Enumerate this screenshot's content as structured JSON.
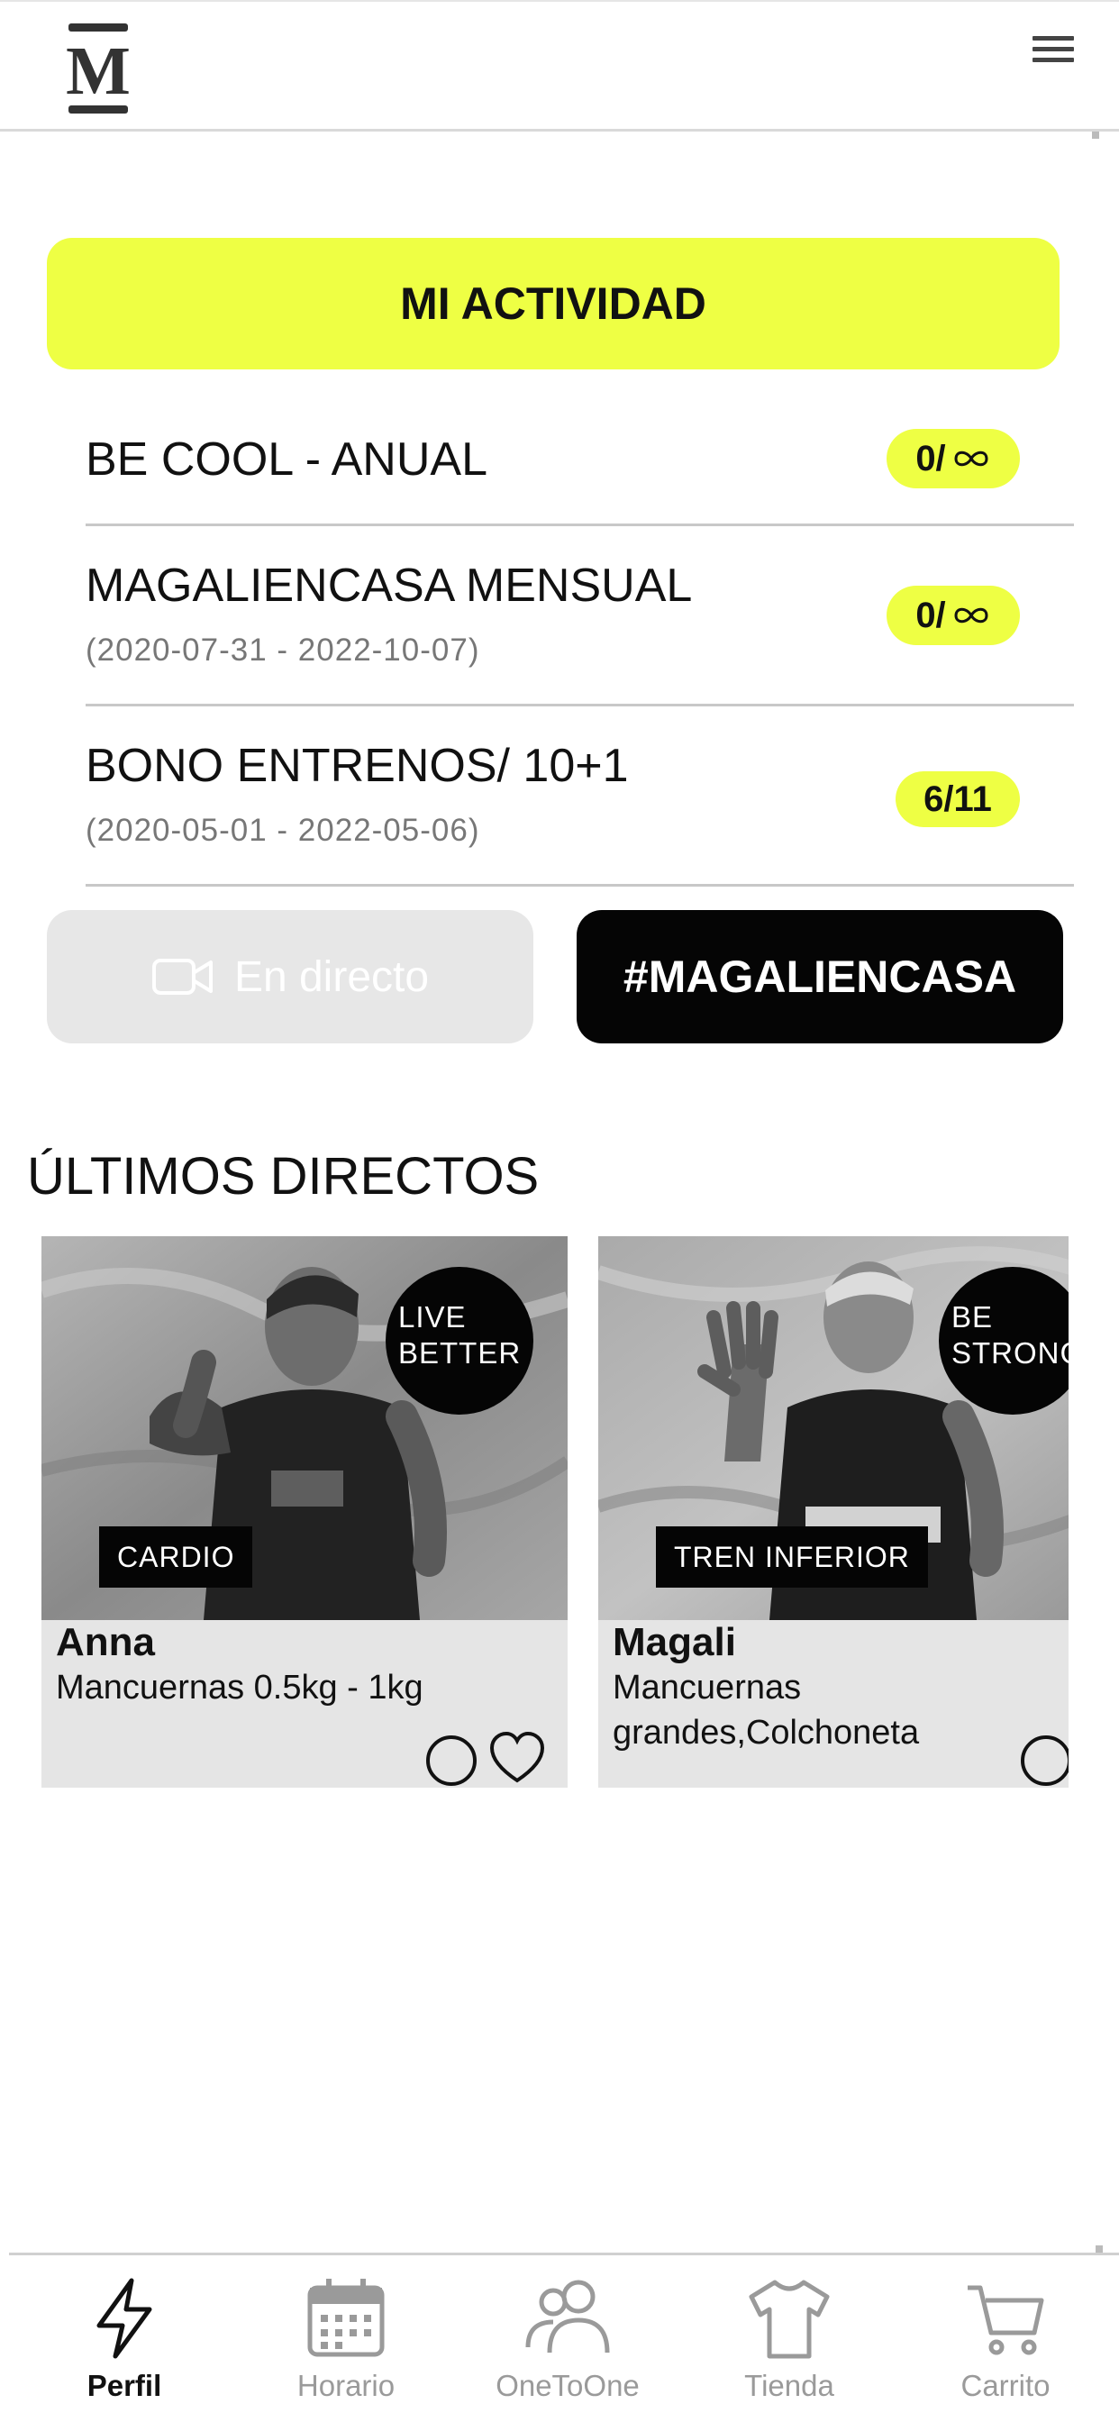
{
  "header": {
    "logo_letter": "M",
    "menu_icon": "hamburger-menu-icon"
  },
  "activity": {
    "button_label": "MI ACTIVIDAD",
    "plans": [
      {
        "name": "BE COOL - ANUAL",
        "dates": "",
        "badge_count": "0/",
        "badge_icon": "infinity-icon"
      },
      {
        "name": "MAGALIENCASA MENSUAL",
        "dates": "(2020-07-31 - 2022-10-07)",
        "badge_count": "0/",
        "badge_icon": "infinity-icon"
      },
      {
        "name": "BONO ENTRENOS/ 10+1",
        "dates": "(2020-05-01 - 2022-05-06)",
        "badge_count": "6/11"
      }
    ]
  },
  "buttons": {
    "live_label": "En directo",
    "live_icon": "video-camera-icon",
    "hashtag_label": "#MAGALIENCASA"
  },
  "section": {
    "title": "ÚLTIMOS DIRECTOS"
  },
  "cards": [
    {
      "badge_line1": "LIVE",
      "badge_line2": "BETTER",
      "category": "CARDIO",
      "name": "Anna",
      "equipment": "Mancuernas 0.5kg - 1kg"
    },
    {
      "badge_line1": "BE",
      "badge_line2": "STRONG",
      "category": "TREN INFERIOR",
      "name": "Magali",
      "equipment": "Mancuernas grandes,Colchoneta"
    }
  ],
  "bottom_nav": [
    {
      "label": "Perfil",
      "icon": "lightning-bolt-icon",
      "active": true
    },
    {
      "label": "Horario",
      "icon": "calendar-icon",
      "active": false
    },
    {
      "label": "OneToOne",
      "icon": "people-icon",
      "active": false
    },
    {
      "label": "Tienda",
      "icon": "tshirt-icon",
      "active": false
    },
    {
      "label": "Carrito",
      "icon": "shopping-cart-icon",
      "active": false
    }
  ],
  "colors": {
    "accent": "#eeff44",
    "dark": "#050505",
    "muted": "#9a9a9a"
  }
}
